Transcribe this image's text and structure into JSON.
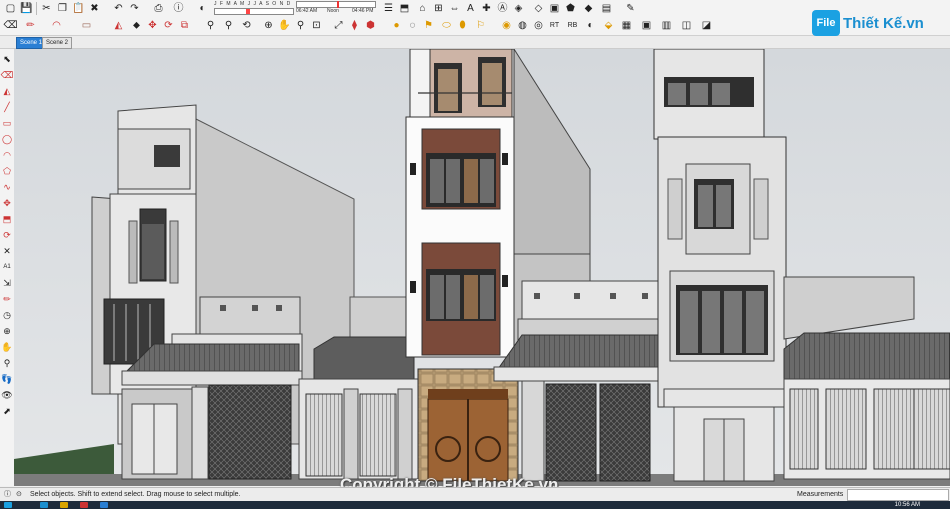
{
  "app": {
    "brand_logo": {
      "box_text": "File",
      "text": "Thiết Kế.vn"
    }
  },
  "toolbar1": {
    "months_label": "J F M A M J J A S O N D",
    "time_start": "06:42 AM",
    "time_mid": "Noon",
    "time_end": "04:46 PM",
    "icons": [
      "new-file-icon",
      "save-icon",
      "cut-icon",
      "copy-icon",
      "paste-icon",
      "erase-icon",
      "undo-icon",
      "redo-icon",
      "print-icon",
      "model-info-icon",
      "shadow-icon",
      "fog-icon",
      "section-plane-icon",
      "section-cut-icon",
      "section-display-icon",
      "dimension-icon",
      "text-icon",
      "axes-icon",
      "3d-text-icon",
      "tape-icon",
      "protractor-icon",
      "position-camera-icon",
      "walk-icon",
      "look-around-icon",
      "scenes-icon"
    ]
  },
  "toolbar2": {
    "icons": [
      "eraser-icon",
      "pencil-icon",
      "arc-icon",
      "rectangle-icon",
      "paint-bucket-icon",
      "select-icon",
      "move-icon",
      "rotate-icon",
      "scale-icon",
      "push-pull-icon",
      "follow-me-icon",
      "offset-icon",
      "orbit-icon",
      "pan-icon",
      "zoom-icon",
      "zoom-window-icon",
      "zoom-extents-icon",
      "previous-view-icon",
      "3d-warehouse-icon",
      "extension-icon",
      "components-icon",
      "materials-icon",
      "styles-icon",
      "layers-icon",
      "sandbox-icon",
      "texture-icon",
      "plugin-icon",
      "render-icon"
    ]
  },
  "scenes": {
    "tabs": [
      "Scene 1",
      "Scene 2"
    ],
    "active": "Scene 1"
  },
  "left_tools": [
    "select-icon",
    "eraser-icon",
    "paint-icon",
    "line-icon",
    "rectangle-icon",
    "circle-icon",
    "arc-icon",
    "polygon-icon",
    "freehand-icon",
    "move-icon",
    "push-pull-icon",
    "rotate-icon",
    "follow-me-icon",
    "scale-icon",
    "offset-icon",
    "tape-measure-icon",
    "dimension-icon",
    "protractor-icon",
    "text-icon",
    "axes-icon",
    "3d-text-icon",
    "orbit-icon",
    "pan-icon",
    "zoom-icon",
    "zoom-window-icon",
    "zoom-extents-icon",
    "walk-icon",
    "look-around-icon",
    "position-camera-icon",
    "section-icon"
  ],
  "watermark": "Copyright © FileThietKe.vn",
  "status": {
    "text": "Select objects. Shift to extend select. Drag mouse to select multiple.",
    "measurements_label": "Measurements",
    "measurements_value": ""
  },
  "taskbar": {
    "clock": "10:56 AM"
  },
  "colors": {
    "accent": "#2a7fd4",
    "brand": "#1ba1e2",
    "sky": "#d9dde1",
    "facade_white": "#ffffff",
    "facade_grey": "#d7d7d7",
    "brick": "#7b4a3a",
    "wood": "#9c6334"
  }
}
